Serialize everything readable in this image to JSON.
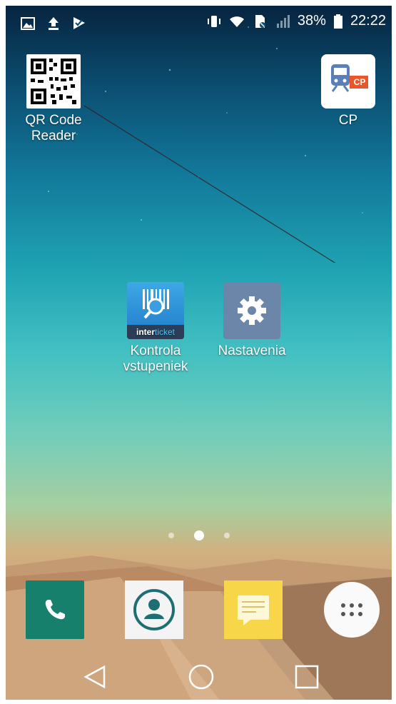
{
  "status_bar": {
    "battery_percent": "38%",
    "time": "22:22",
    "left_icons": [
      "image-icon",
      "upload-icon",
      "check-flag-icon"
    ],
    "right_icons": [
      "vibrate-icon",
      "wifi-icon",
      "no-sim-icon",
      "signal-icon",
      "battery-icon"
    ]
  },
  "apps": [
    {
      "label": "QR Code\nReader",
      "icon": "qr-code-icon"
    },
    {
      "label": "CP",
      "icon": "train-icon",
      "badge": "CP"
    },
    {
      "label": "Kontrola\nvstupeniek",
      "icon": "barcode-search-icon",
      "brand_a": "inter",
      "brand_b": "ticket"
    },
    {
      "label": "Nastavenia",
      "icon": "gear-icon"
    }
  ],
  "pager": {
    "page_count": 3,
    "active_page": 2
  },
  "dock": [
    {
      "name": "phone",
      "icon": "phone-icon"
    },
    {
      "name": "contacts",
      "icon": "contact-icon"
    },
    {
      "name": "messages",
      "icon": "message-icon"
    },
    {
      "name": "apps",
      "icon": "app-drawer-icon"
    }
  ],
  "nav_bar": {
    "buttons": [
      "back-icon",
      "home-icon",
      "recent-apps-icon"
    ]
  },
  "colors": {
    "phone_app": "#16806d",
    "messages_app": "#f7d64a",
    "cp_brand": "#e8562a",
    "settings_icon": "#6c86aa"
  }
}
